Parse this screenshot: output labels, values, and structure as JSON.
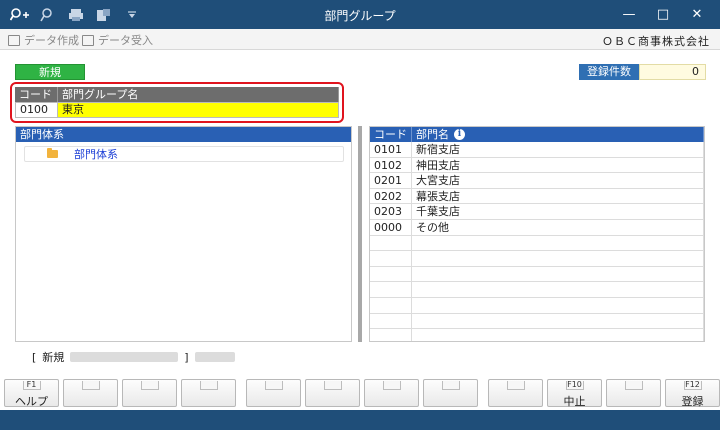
{
  "window": {
    "title": "部門グループ"
  },
  "titlebar_icons": [
    "key-add-icon",
    "search-icon",
    "printer-icon",
    "export-icon",
    "dropdown-icon"
  ],
  "window_controls": {
    "minimize": "—",
    "maximize": "□",
    "close": "✕"
  },
  "menu": {
    "items": [
      {
        "label": "データ作成",
        "icon": "export-icon"
      },
      {
        "label": "データ受入",
        "icon": "import-icon"
      }
    ],
    "company": "ＯＢＣ商事株式会社"
  },
  "mode_badge": "新規",
  "count": {
    "label": "登録件数",
    "value": "0"
  },
  "group": {
    "header_code": "コード",
    "header_name": "部門グループ名",
    "code": "0100",
    "name": "東京"
  },
  "left_panel": {
    "header": "部門体系",
    "tree_item": "部門体系"
  },
  "right_table": {
    "header_code": "コード",
    "header_name": "部門名",
    "rows": [
      {
        "code": "0101",
        "name": "新宿支店"
      },
      {
        "code": "0102",
        "name": "神田支店"
      },
      {
        "code": "0201",
        "name": "大宮支店"
      },
      {
        "code": "0202",
        "name": "幕張支店"
      },
      {
        "code": "0203",
        "name": "千葉支店"
      },
      {
        "code": "0000",
        "name": "その他"
      },
      {
        "code": "",
        "name": ""
      },
      {
        "code": "",
        "name": ""
      },
      {
        "code": "",
        "name": ""
      },
      {
        "code": "",
        "name": ""
      },
      {
        "code": "",
        "name": ""
      },
      {
        "code": "",
        "name": ""
      },
      {
        "code": "",
        "name": ""
      }
    ]
  },
  "status": {
    "bracket_open": "[",
    "mode": "新規",
    "bracket_close": "]"
  },
  "fkeys": [
    {
      "num": "F1",
      "label": "ヘルプ"
    },
    {
      "num": "",
      "label": ""
    },
    {
      "num": "",
      "label": ""
    },
    {
      "num": "",
      "label": ""
    },
    {
      "num": "",
      "label": ""
    },
    {
      "num": "",
      "label": ""
    },
    {
      "num": "",
      "label": ""
    },
    {
      "num": "",
      "label": ""
    },
    {
      "num": "",
      "label": ""
    },
    {
      "num": "F10",
      "label": "中止"
    },
    {
      "num": "",
      "label": ""
    },
    {
      "num": "F12",
      "label": "登録"
    }
  ]
}
